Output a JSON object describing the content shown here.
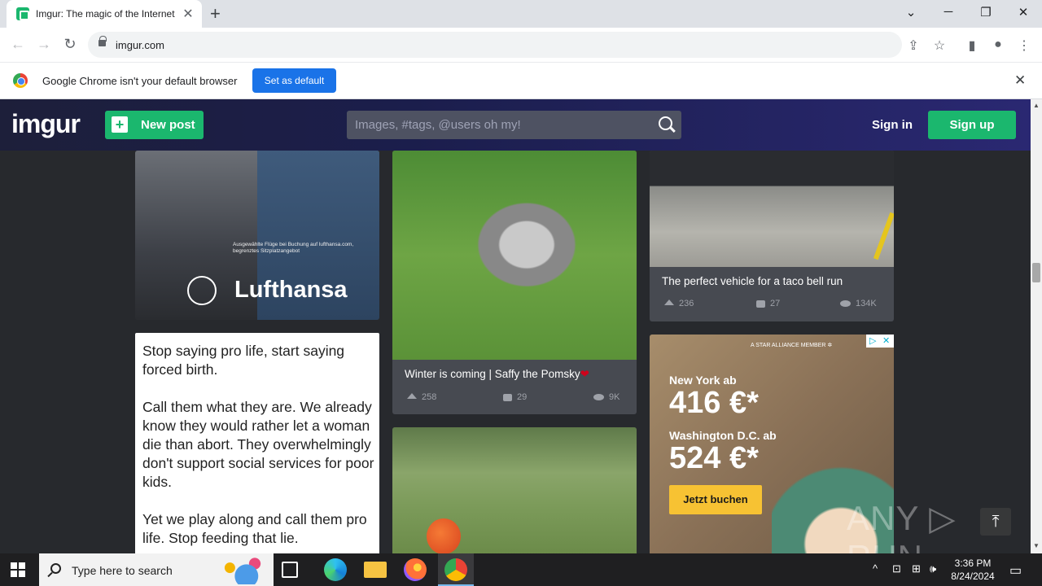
{
  "browser": {
    "tab_title": "Imgur: The magic of the Internet",
    "tab_close": "✕",
    "new_tab": "+",
    "url": "imgur.com",
    "window_controls": {
      "dropdown": "⌄",
      "minimize": "─",
      "restore": "❐",
      "close": "✕"
    },
    "nav": {
      "back": "←",
      "forward": "→",
      "reload": "↻"
    },
    "toolbar_icons": {
      "share": "⇪",
      "bookmark": "☆",
      "sidepanel": "▮",
      "profile": "●",
      "menu": "⋮"
    }
  },
  "infobar": {
    "message": "Google Chrome isn't your default browser",
    "button": "Set as default",
    "close": "✕"
  },
  "imgur_header": {
    "logo": "imgur",
    "new_post": "New post",
    "new_post_icon": "+",
    "search_placeholder": "Images, #tags, @users oh my!",
    "sign_in": "Sign in",
    "sign_up": "Sign up"
  },
  "ads": {
    "lufthansa": {
      "small_text": "Ausgewählte Flüge bei Buchung auf lufthansa.com, begrenztes Sitzplatzangebot",
      "brand": "Lufthansa"
    },
    "flight": {
      "badge": "A STAR ALLIANCE MEMBER ✲",
      "city1": "New York ab",
      "price1": "416 €*",
      "city2": "Washington D.C. ab",
      "price2": "524 €*",
      "cta": "Jetzt buchen",
      "adchoices": "▷",
      "adclose": "✕"
    }
  },
  "posts": {
    "text_post": {
      "p1": "Stop saying pro life, start saying forced birth.",
      "p2": "Call them what they are. We already know they would rather let a woman die than abort. They overwhelmingly don't support social services for poor kids.",
      "p3": "Yet we play along and call them pro life. Stop feeding that lie."
    },
    "dog": {
      "caption": "Winter is coming | Saffy the Pomsky",
      "heart": "❤",
      "upvotes": "258",
      "comments": "29",
      "views": "9K"
    },
    "truck": {
      "caption": "The perfect vehicle for a taco bell run",
      "upvotes": "236",
      "comments": "27",
      "views": "134K"
    }
  },
  "watermark": "ANY ▷ RUN",
  "back_to_top": "⤒",
  "taskbar": {
    "search_placeholder": "Type here to search",
    "time": "3:36 PM",
    "date": "8/24/2024",
    "tray": {
      "chevron": "^",
      "network": "⊡",
      "speaker": "🕪",
      "notifications": "▭"
    }
  },
  "colors": {
    "imgur_green": "#1bb76e",
    "feed_background": "#27292d",
    "card_background": "#474a51",
    "chrome_blue": "#1a73e8"
  }
}
